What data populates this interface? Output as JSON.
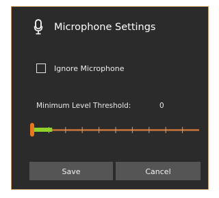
{
  "dialog": {
    "title": "Microphone Settings",
    "icon": "microphone-icon"
  },
  "ignore_microphone": {
    "label": "Ignore Microphone",
    "checked": false
  },
  "threshold": {
    "label": "Minimum Level Threshold:",
    "value": "0",
    "slider_level": 0,
    "level_meter_fraction": 0.12
  },
  "buttons": {
    "save_label": "Save",
    "cancel_label": "Cancel"
  },
  "colors": {
    "background": "#2b2b2b",
    "accent_orange": "#e8781e",
    "level_green": "#8fd22a",
    "track": "#b06a3a",
    "button": "#555555"
  }
}
